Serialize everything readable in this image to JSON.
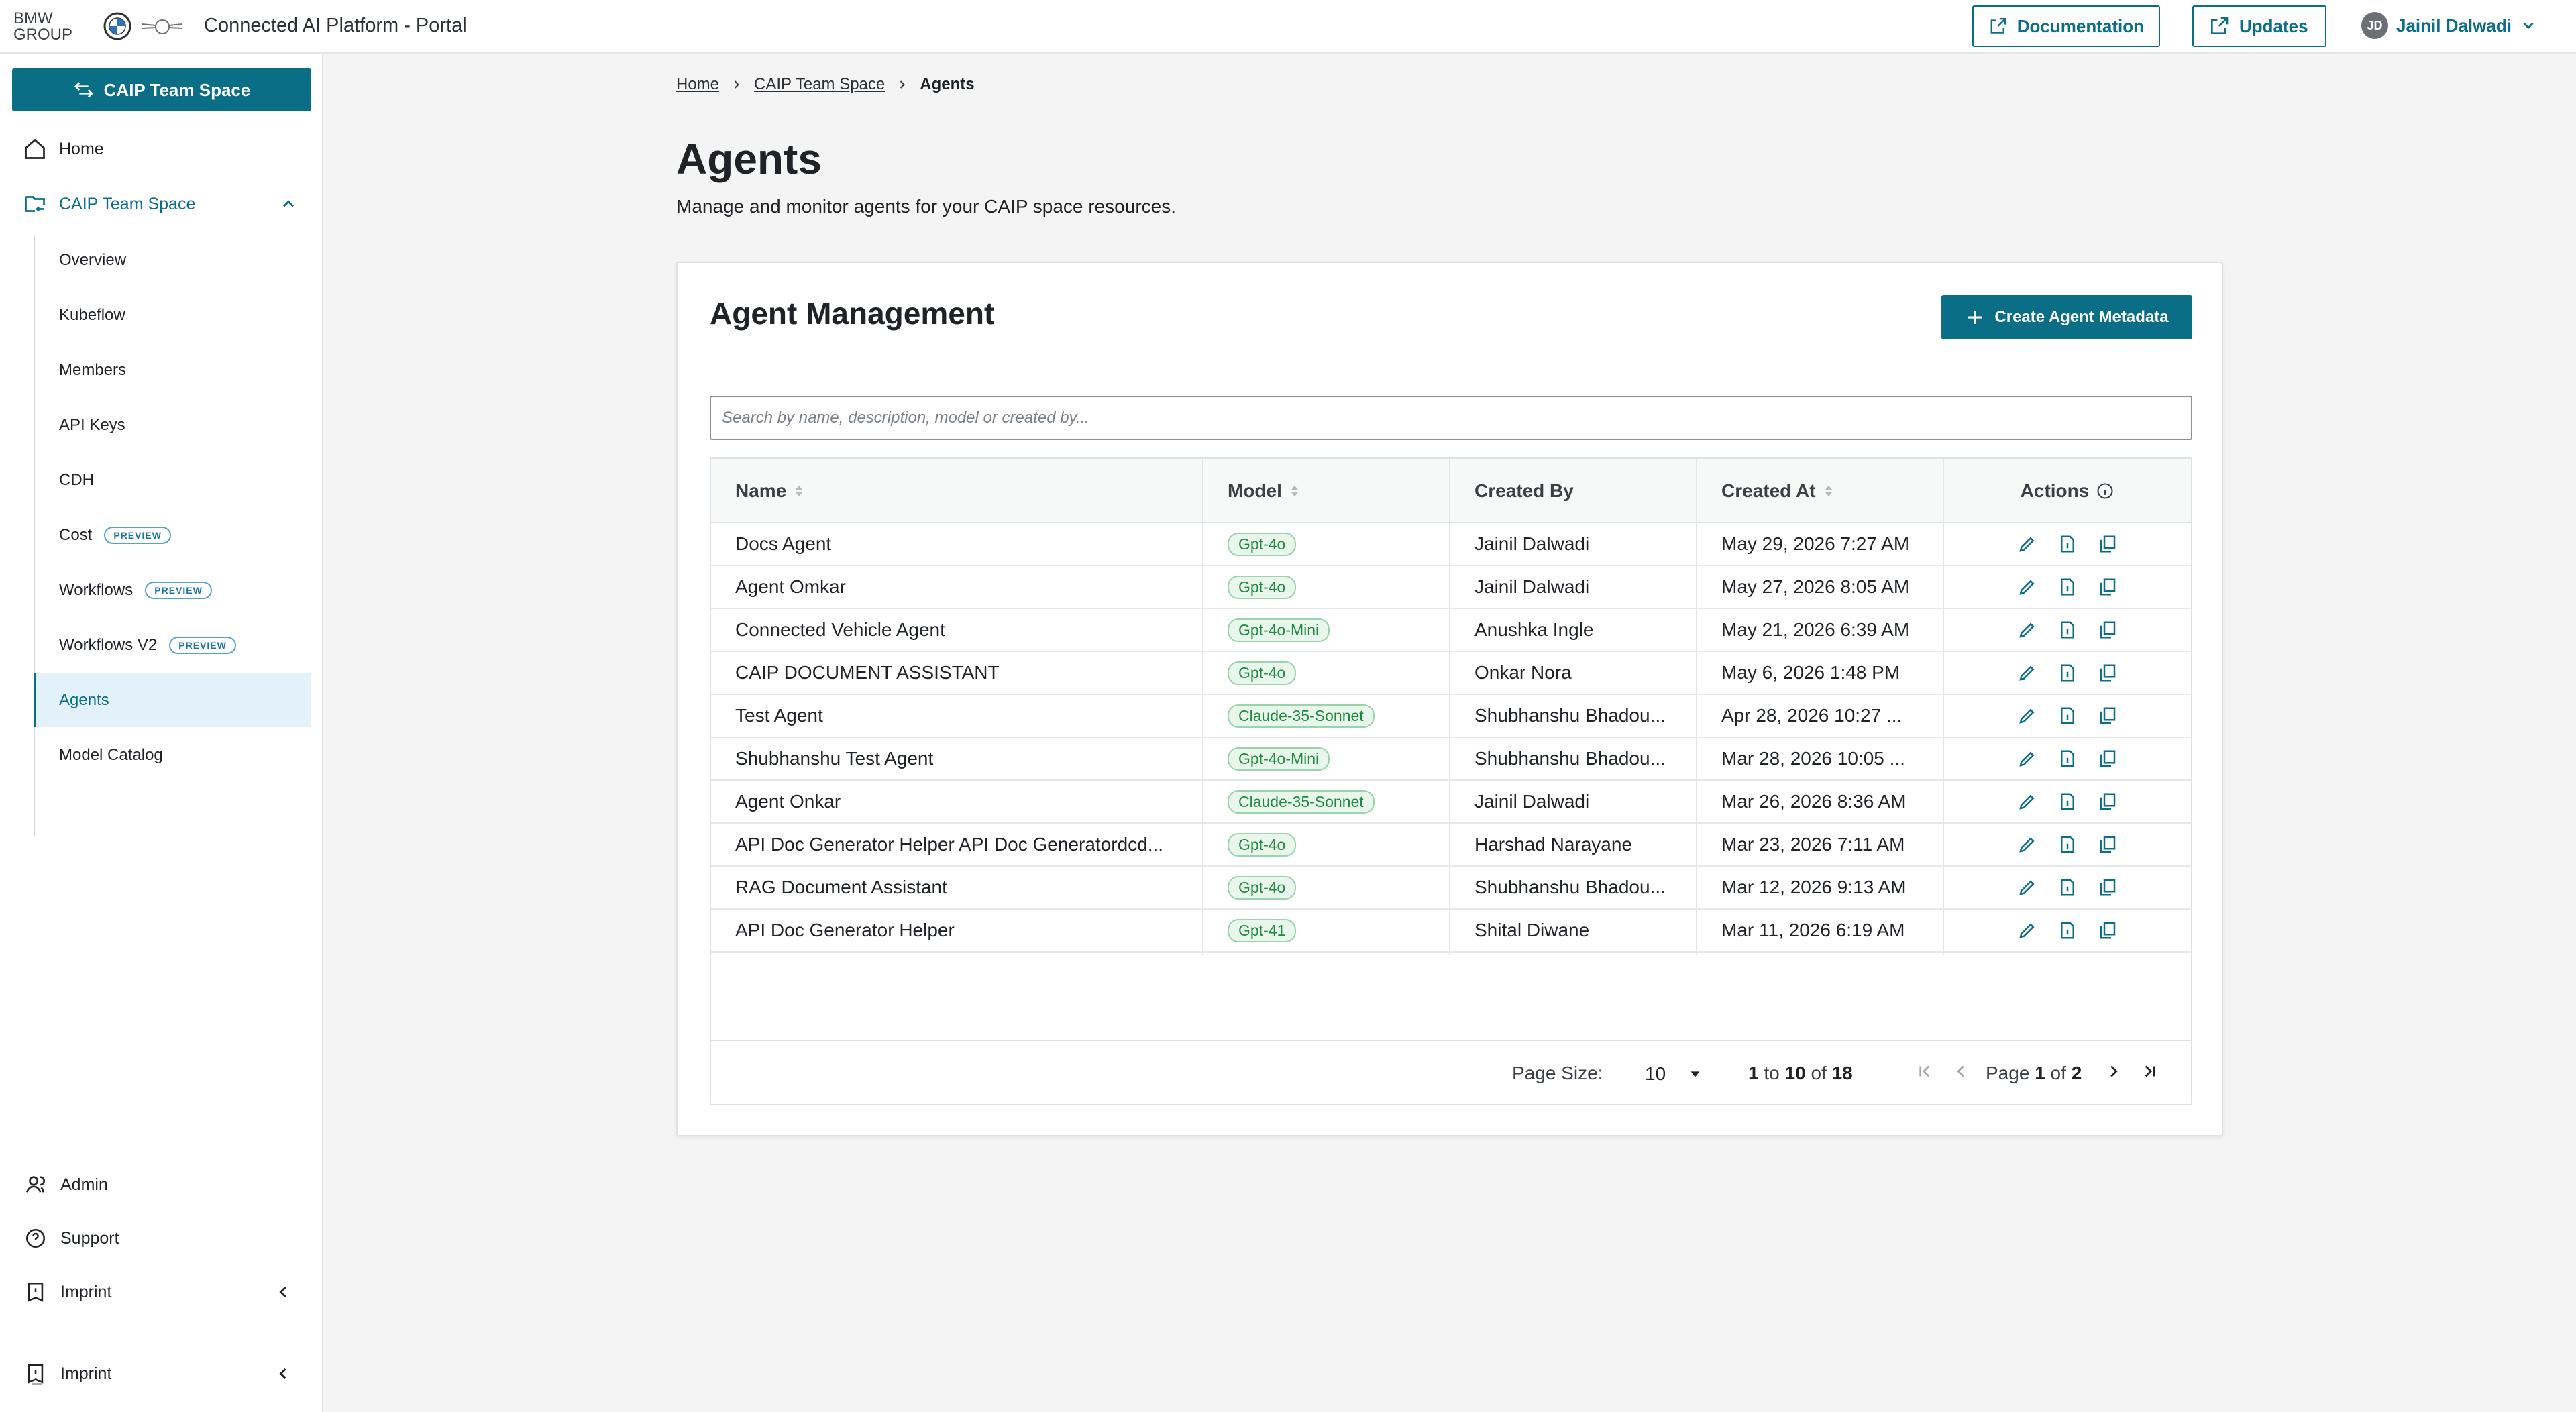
{
  "header": {
    "brand": "BMW GROUP",
    "brand_line1": "BMW",
    "brand_line2": "GROUP",
    "app_title": "Connected AI Platform - Portal",
    "documentation_label": "Documentation",
    "updates_label": "Updates",
    "user_initials": "JD",
    "user_name": "Jainil Dalwadi"
  },
  "sidebar": {
    "team_button_label": "CAIP Team Space",
    "home_label": "Home",
    "team_label": "CAIP Team Space",
    "sub_items": [
      {
        "label": "Overview",
        "badge": ""
      },
      {
        "label": "Kubeflow",
        "badge": ""
      },
      {
        "label": "Members",
        "badge": ""
      },
      {
        "label": "API Keys",
        "badge": ""
      },
      {
        "label": "CDH",
        "badge": ""
      },
      {
        "label": "Cost",
        "badge": "PREVIEW"
      },
      {
        "label": "Workflows",
        "badge": "PREVIEW"
      },
      {
        "label": "Workflows V2",
        "badge": "PREVIEW"
      },
      {
        "label": "Agents",
        "badge": ""
      },
      {
        "label": "Model Catalog",
        "badge": ""
      }
    ],
    "active_item": "Agents",
    "bottom": {
      "admin_label": "Admin",
      "support_label": "Support",
      "imprint_label": "Imprint",
      "imprint2_label": "Imprint"
    }
  },
  "breadcrumb": {
    "home": "Home",
    "space": "CAIP Team Space",
    "current": "Agents"
  },
  "page": {
    "title": "Agents",
    "description": "Manage and monitor agents for your CAIP space resources."
  },
  "card": {
    "title": "Agent Management",
    "create_label": "Create Agent Metadata",
    "search_placeholder": "Search by name, description, model or created by..."
  },
  "table": {
    "columns": {
      "name": "Name",
      "model": "Model",
      "created_by": "Created By",
      "created_at": "Created At",
      "actions": "Actions"
    },
    "rows": [
      {
        "name": "Docs Agent",
        "model": "Gpt-4o",
        "created_by": "Jainil Dalwadi",
        "created_at": "May 29, 2026 7:27 AM"
      },
      {
        "name": "Agent Omkar",
        "model": "Gpt-4o",
        "created_by": "Jainil Dalwadi",
        "created_at": "May 27, 2026 8:05 AM"
      },
      {
        "name": "Connected Vehicle Agent",
        "model": "Gpt-4o-Mini",
        "created_by": "Anushka Ingle",
        "created_at": "May 21, 2026 6:39 AM"
      },
      {
        "name": "CAIP DOCUMENT ASSISTANT",
        "model": "Gpt-4o",
        "created_by": "Onkar Nora",
        "created_at": "May 6, 2026 1:48 PM"
      },
      {
        "name": "Test Agent",
        "model": "Claude-35-Sonnet",
        "created_by": "Shubhanshu Bhadou...",
        "created_at": "Apr 28, 2026 10:27 ..."
      },
      {
        "name": "Shubhanshu Test Agent",
        "model": "Gpt-4o-Mini",
        "created_by": "Shubhanshu Bhadou...",
        "created_at": "Mar 28, 2026 10:05 ..."
      },
      {
        "name": "Agent Onkar",
        "model": "Claude-35-Sonnet",
        "created_by": "Jainil Dalwadi",
        "created_at": "Mar 26, 2026 8:36 AM"
      },
      {
        "name": "API Doc Generator Helper API Doc Generatordcd...",
        "model": "Gpt-4o",
        "created_by": "Harshad Narayane",
        "created_at": "Mar 23, 2026 7:11 AM"
      },
      {
        "name": "RAG Document Assistant",
        "model": "Gpt-4o",
        "created_by": "Shubhanshu Bhadou...",
        "created_at": "Mar 12, 2026 9:13 AM"
      },
      {
        "name": "API Doc Generator Helper",
        "model": "Gpt-41",
        "created_by": "Shital Diwane",
        "created_at": "Mar 11, 2026 6:19 AM"
      }
    ]
  },
  "pagination": {
    "page_size_label": "Page Size:",
    "page_size": "10",
    "range_from": "1",
    "range_to_word": "to",
    "range_to": "10",
    "range_of_word": "of",
    "range_total": "18",
    "page_word": "Page",
    "page_current": "1",
    "page_of_word": "of",
    "page_total": "2"
  },
  "colors": {
    "accent": "#0a6e86",
    "chip_bg": "#e8f6ec",
    "chip_text": "#1f8a3e",
    "active_bg": "#e3f1fb"
  }
}
